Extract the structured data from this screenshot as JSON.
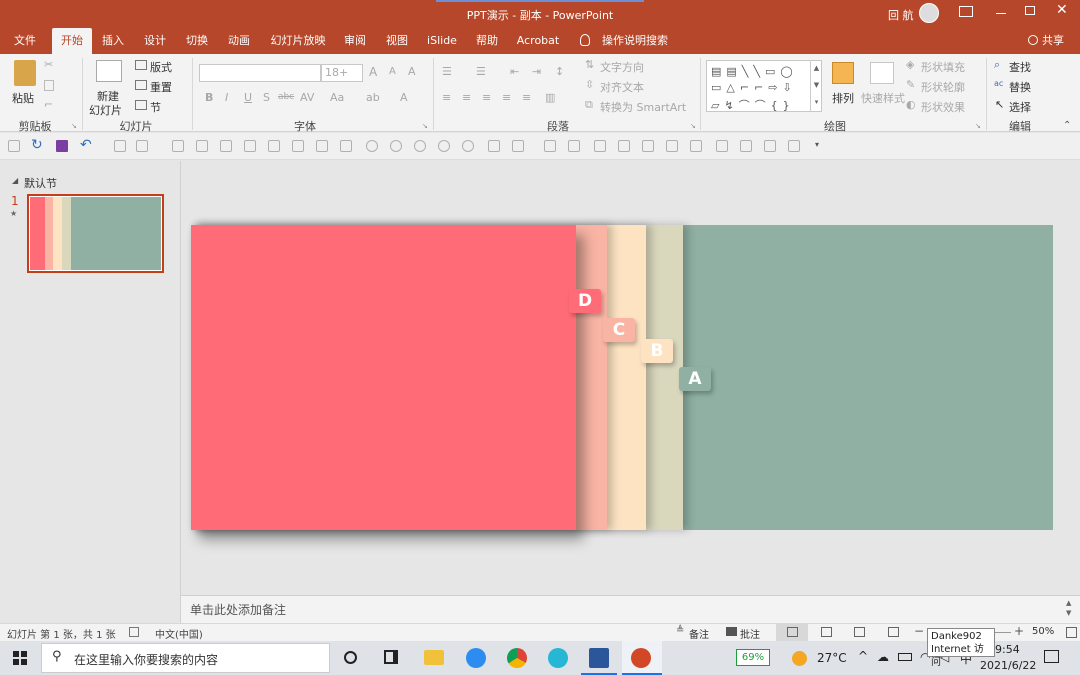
{
  "app": {
    "title": "PPT演示 - 副本  -  PowerPoint",
    "user": "回 航"
  },
  "tabs": [
    "文件",
    "开始",
    "插入",
    "设计",
    "切换",
    "动画",
    "幻灯片放映",
    "审阅",
    "视图",
    "iSlide",
    "帮助",
    "Acrobat"
  ],
  "tell_me": "操作说明搜索",
  "share": "共享",
  "ribbon": {
    "clipboard": {
      "paste": "粘贴",
      "label": "剪贴板"
    },
    "slides": {
      "new_slide_1": "新建",
      "new_slide_2": "幻灯片",
      "layout": "版式",
      "reset": "重置",
      "section": "节",
      "label": "幻灯片"
    },
    "font": {
      "size": "18+",
      "bold": "B",
      "italic": "I",
      "underline": "U",
      "shadow": "S",
      "strike": "abc",
      "spacing": "AV",
      "case": "Aa",
      "label": "字体"
    },
    "paragraph": {
      "text_dir": "文字方向",
      "align_text": "对齐文本",
      "smartart": "转换为 SmartArt",
      "label": "段落"
    },
    "drawing": {
      "arrange": "排列",
      "quick_styles": "快速样式",
      "fill": "形状填充",
      "outline": "形状轮廓",
      "effects": "形状效果",
      "label": "绘图"
    },
    "editing": {
      "find": "查找",
      "replace": "替换",
      "select": "选择",
      "label": "编辑"
    }
  },
  "thumbs": {
    "section": "默认节",
    "slide_num": "1"
  },
  "slide": {
    "tabs": [
      "D",
      "C",
      "B",
      "A"
    ],
    "colors": {
      "red": "#ff6b76",
      "salmon": "#f9b4a4",
      "cream": "#fde3c2",
      "beige": "#d9d7bc",
      "sage": "#8fb0a3"
    }
  },
  "notes_placeholder": "单击此处添加备注",
  "status": {
    "slide_info": "幻灯片 第 1 张，共 1 张",
    "language": "中文(中国)",
    "notes": "备注",
    "comments": "批注",
    "zoom": "50%"
  },
  "taskbar": {
    "search_placeholder": "在这里输入你要搜索的内容",
    "battery": "69%",
    "temp": "27°C",
    "ime": "中",
    "time": "9:54",
    "date": "2021/6/22"
  },
  "tooltip": {
    "line1": "Danke902",
    "line2": "Internet 访问"
  }
}
